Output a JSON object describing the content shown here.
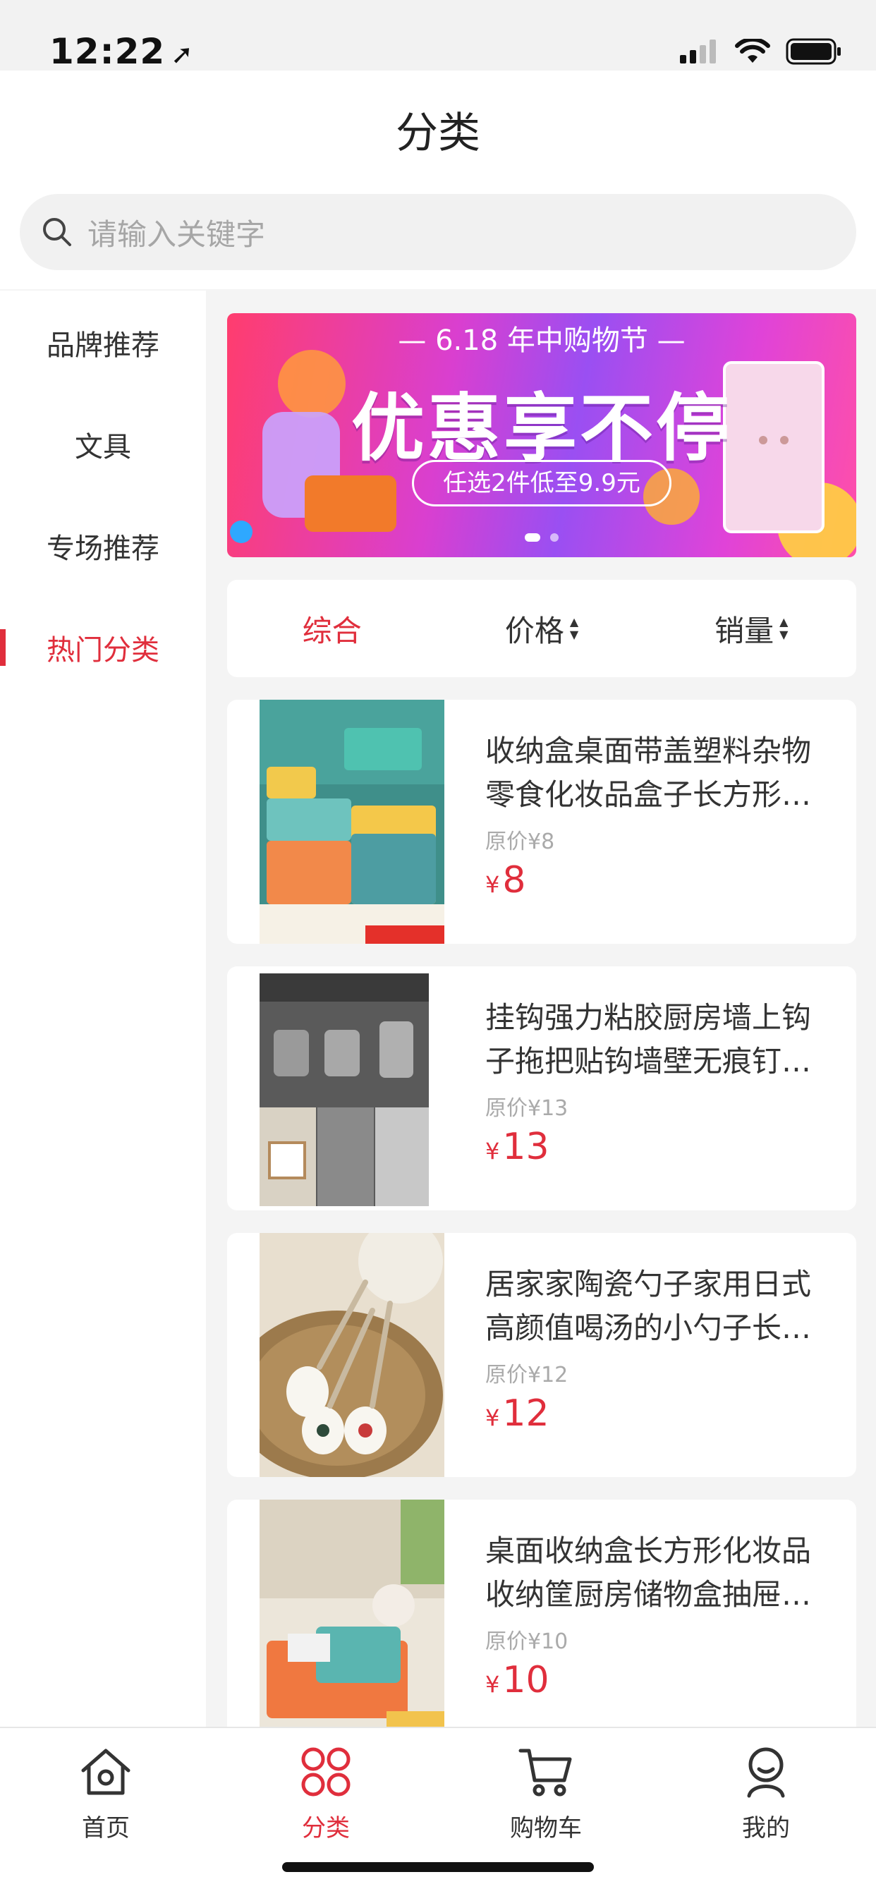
{
  "status_bar": {
    "time": "12:22",
    "location_icon": "location-arrow-icon"
  },
  "header": {
    "title": "分类",
    "search": {
      "placeholder": "请输入关键字"
    }
  },
  "sidebar": {
    "items": [
      {
        "label": "品牌推荐",
        "active": false
      },
      {
        "label": "文具",
        "active": false
      },
      {
        "label": "专场推荐",
        "active": false
      },
      {
        "label": "热门分类",
        "active": true
      }
    ]
  },
  "banner": {
    "top_text": "— 6.18 年中购物节 —",
    "main_text": "优惠享不停",
    "sub_text": "任选2件低至9.9元"
  },
  "sort_bar": {
    "items": [
      {
        "label": "综合",
        "active": true,
        "sortable": false
      },
      {
        "label": "价格",
        "active": false,
        "sortable": true
      },
      {
        "label": "销量",
        "active": false,
        "sortable": true
      }
    ]
  },
  "products": [
    {
      "name": "收纳盒桌面带盖塑料杂物零食化妆品盒子长方形收纳箱",
      "original": "原价¥8",
      "currency": "¥",
      "price": "8"
    },
    {
      "name": "挂钩强力粘胶厨房墙上钩子拖把贴钩墙壁无痕钉挂钩",
      "original": "原价¥13",
      "currency": "¥",
      "price": "13"
    },
    {
      "name": "居家家陶瓷勺子家用日式高颜值喝汤的小勺子长柄汤勺",
      "original": "原价¥12",
      "currency": "¥",
      "price": "12"
    },
    {
      "name": "桌面收纳盒长方形化妆品收纳筐厨房储物盒抽屉整理盒",
      "original": "原价¥10",
      "currency": "¥",
      "price": "10"
    }
  ],
  "tabbar": {
    "items": [
      {
        "label": "首页",
        "icon": "home-icon",
        "active": false
      },
      {
        "label": "分类",
        "icon": "category-icon",
        "active": true
      },
      {
        "label": "购物车",
        "icon": "cart-icon",
        "active": false
      },
      {
        "label": "我的",
        "icon": "profile-icon",
        "active": false
      }
    ]
  },
  "colors": {
    "accent": "#e02e3c",
    "background": "#f4f4f4"
  }
}
